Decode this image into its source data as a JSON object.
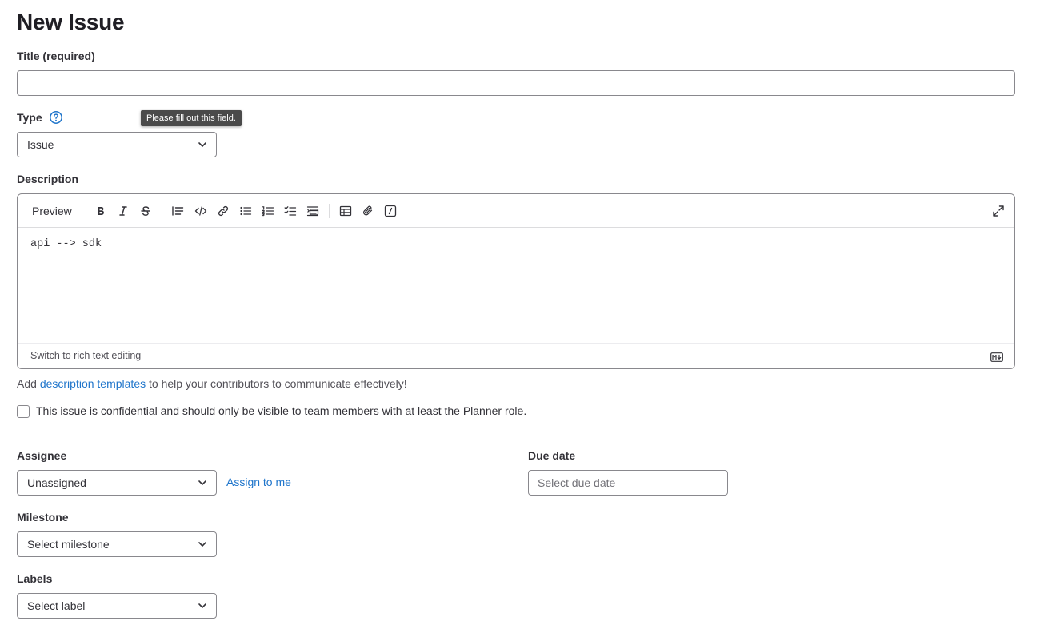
{
  "page": {
    "title": "New Issue"
  },
  "title_field": {
    "label": "Title (required)",
    "value": "",
    "placeholder": ""
  },
  "tooltip": {
    "text": "Please fill out this field."
  },
  "type_field": {
    "label": "Type",
    "help_icon": "question-circle-icon",
    "selected": "Issue"
  },
  "description": {
    "label": "Description",
    "preview_label": "Preview",
    "toolbar_icons": [
      "bold-icon",
      "italic-icon",
      "strikethrough-icon",
      "quote-icon",
      "code-icon",
      "link-icon",
      "bulleted-list-icon",
      "numbered-list-icon",
      "task-list-icon",
      "indent-icon",
      "table-icon",
      "attachment-icon",
      "slash-command-icon",
      "fullscreen-icon"
    ],
    "content": "api --> sdk",
    "switch_label": "Switch to rich text editing",
    "markdown_icon": "markdown-icon"
  },
  "templates_hint": {
    "prefix": "Add ",
    "link": "description templates",
    "suffix": " to help your contributors to communicate effectively!"
  },
  "confidential": {
    "checked": false,
    "label": "This issue is confidential and should only be visible to team members with at least the Planner role."
  },
  "assignee": {
    "label": "Assignee",
    "selected": "Unassigned",
    "assign_to_me": "Assign to me"
  },
  "due_date": {
    "label": "Due date",
    "placeholder": "Select due date"
  },
  "milestone": {
    "label": "Milestone",
    "selected": "Select milestone"
  },
  "labels": {
    "label": "Labels",
    "selected": "Select label"
  },
  "colors": {
    "link": "#1f75cb",
    "text": "#333238",
    "border": "#89888d",
    "tooltip_bg": "#4a4a4a"
  }
}
